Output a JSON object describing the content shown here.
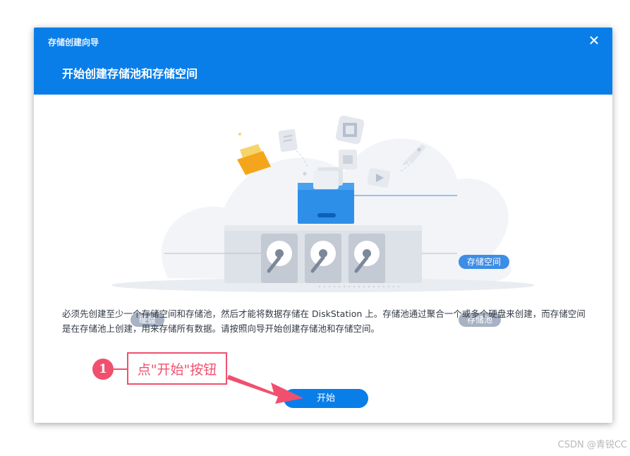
{
  "window": {
    "title": "存储创建向导",
    "close_icon": "close-icon"
  },
  "header": {
    "heading": "开始创建存储池和存储空间"
  },
  "illustration": {
    "label_volume": "存储空间",
    "label_pool": "存储池",
    "label_disk": "硬盘"
  },
  "description": "必须先创建至少一个存储空间和存储池，然后才能将数据存储在 DiskStation 上。存储池通过聚合一个或多个硬盘来创建，而存储空间是在存储池上创建，用来存储所有数据。请按照向导开始创建存储池和存储空间。",
  "buttons": {
    "start": "开始"
  },
  "annotation": {
    "step_number": "1",
    "text": "点\"开始\"按钮"
  },
  "watermark": "CSDN @青锐CC",
  "colors": {
    "accent": "#0a7ee8",
    "annotation": "#f0506e",
    "pill_gray": "#a7b2c4"
  }
}
